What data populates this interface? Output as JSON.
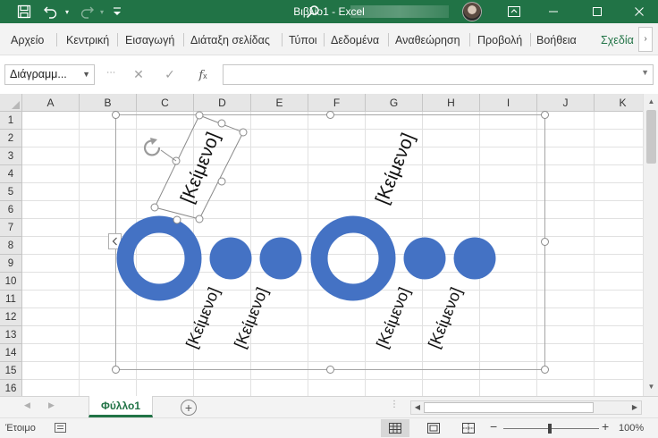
{
  "window": {
    "title_doc": "Βιβλίο1",
    "title_sep": " - ",
    "title_app": "Excel",
    "brand_color": "#217346"
  },
  "titlebar_icons": [
    "save-icon",
    "undo-icon",
    "redo-icon",
    "customize-quick-access-icon",
    "search-icon",
    "ribbon-display-icon",
    "minimize-icon",
    "maximize-icon",
    "close-icon"
  ],
  "ribbon": {
    "tabs": [
      "Αρχείο",
      "Κεντρική",
      "Εισαγωγή",
      "Διάταξη σελίδας",
      "Τύποι",
      "Δεδομένα",
      "Αναθεώρηση",
      "Προβολή",
      "Βοήθεια"
    ],
    "contextual_tab": "Σχεδία"
  },
  "formula_bar": {
    "name_box": "Διάγραμμ...",
    "formula_value": ""
  },
  "grid": {
    "columns": [
      "A",
      "B",
      "C",
      "D",
      "E",
      "F",
      "G",
      "H",
      "I",
      "J",
      "K"
    ],
    "rows": [
      "1",
      "2",
      "3",
      "4",
      "5",
      "6",
      "7",
      "8",
      "9",
      "10",
      "11",
      "12",
      "13",
      "14",
      "15",
      "16"
    ]
  },
  "smartart": {
    "accent_color": "#4472C4",
    "labels": [
      "[Κείμενο]",
      "[Κείμενο]",
      "[Κείμενο]",
      "[Κείμενο]",
      "[Κείμενο]",
      "[Κείμενο]"
    ]
  },
  "sheets": {
    "active": "Φύλλο1",
    "add_icon": "plus-icon"
  },
  "status": {
    "ready": "Έτοιμο",
    "zoom": "100%"
  }
}
